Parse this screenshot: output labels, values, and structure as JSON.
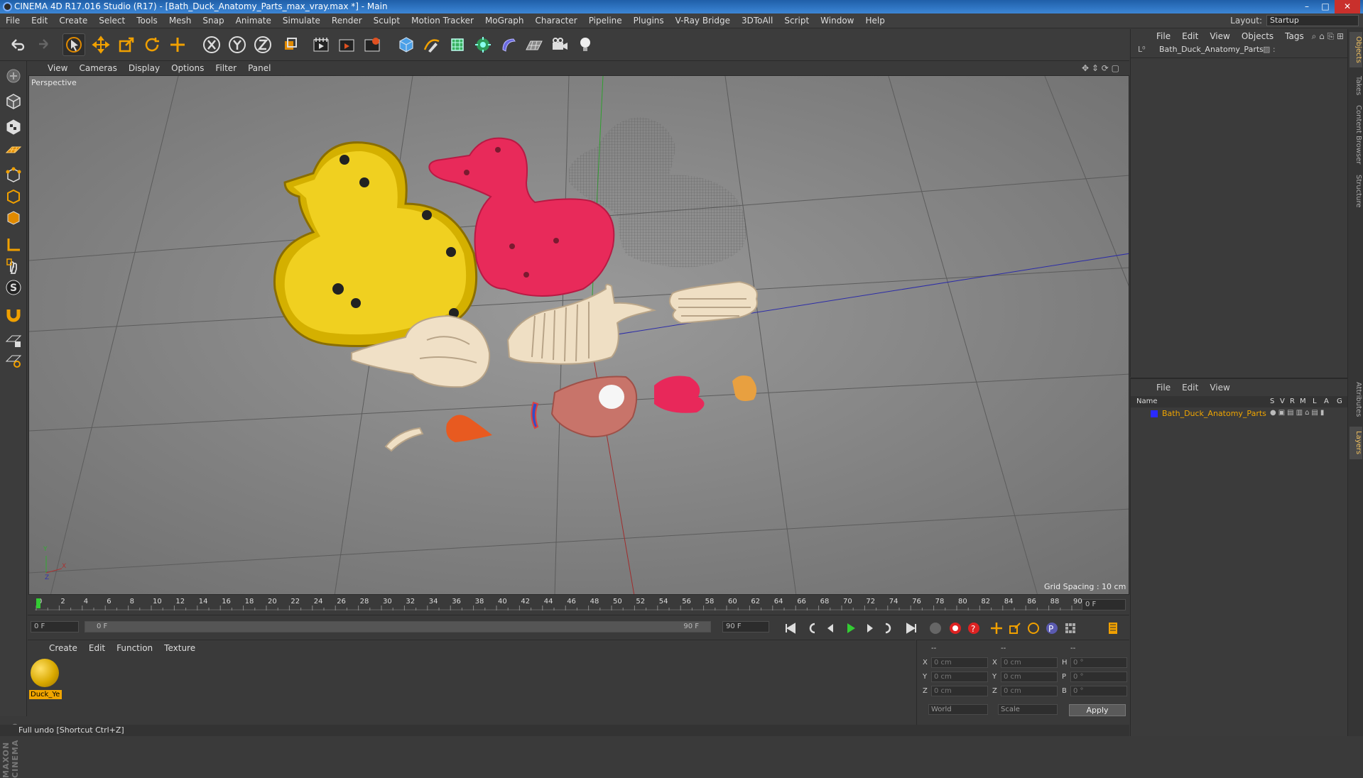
{
  "window": {
    "title": "CINEMA 4D R17.016 Studio (R17) - [Bath_Duck_Anatomy_Parts_max_vray.max *] - Main",
    "min": "–",
    "max": "□",
    "close": "✕"
  },
  "menubar": {
    "items": [
      "File",
      "Edit",
      "Create",
      "Select",
      "Tools",
      "Mesh",
      "Snap",
      "Animate",
      "Simulate",
      "Render",
      "Sculpt",
      "Motion Tracker",
      "MoGraph",
      "Character",
      "Pipeline",
      "Plugins",
      "V-Ray Bridge",
      "3DToAll",
      "Script",
      "Window",
      "Help"
    ],
    "layout_label": "Layout:",
    "layout_value": "Startup"
  },
  "viewport": {
    "menu": [
      "View",
      "Cameras",
      "Display",
      "Options",
      "Filter",
      "Panel"
    ],
    "label": "Perspective",
    "grid_spacing": "Grid Spacing : 10 cm",
    "axis_y": "Y",
    "axis_x": "X",
    "axis_z": "Z"
  },
  "timeline": {
    "ticks": [
      "0",
      "2",
      "4",
      "6",
      "8",
      "10",
      "12",
      "14",
      "16",
      "18",
      "20",
      "22",
      "24",
      "26",
      "28",
      "30",
      "32",
      "34",
      "36",
      "38",
      "40",
      "42",
      "44",
      "46",
      "48",
      "50",
      "52",
      "54",
      "56",
      "58",
      "60",
      "62",
      "64",
      "66",
      "68",
      "70",
      "72",
      "74",
      "76",
      "78",
      "80",
      "82",
      "84",
      "86",
      "88",
      "90"
    ],
    "current_frame": "0 F",
    "start_field": "0 F",
    "range_start": "0 F",
    "range_end": "90 F",
    "end_field": "90 F"
  },
  "materials": {
    "menu": [
      "Create",
      "Edit",
      "Function",
      "Texture"
    ],
    "items": [
      {
        "name": "Duck_Ye"
      }
    ]
  },
  "coordinates": {
    "headers": [
      "--",
      "--",
      "--"
    ],
    "rows": [
      {
        "l1": "X",
        "v1": "0 cm",
        "l2": "X",
        "v2": "0 cm",
        "l3": "H",
        "v3": "0 °"
      },
      {
        "l1": "Y",
        "v1": "0 cm",
        "l2": "Y",
        "v2": "0 cm",
        "l3": "P",
        "v3": "0 °"
      },
      {
        "l1": "Z",
        "v1": "0 cm",
        "l2": "Z",
        "v2": "0 cm",
        "l3": "B",
        "v3": "0 °"
      }
    ],
    "mode1": "World",
    "mode2": "Scale",
    "apply": "Apply"
  },
  "status": "Full undo [Shortcut Ctrl+Z]",
  "objects": {
    "menu": [
      "File",
      "Edit",
      "View",
      "Objects",
      "Tags"
    ],
    "tree": [
      {
        "name": "Bath_Duck_Anatomy_Parts"
      }
    ]
  },
  "layers": {
    "menu": [
      "File",
      "Edit",
      "View"
    ],
    "columns": [
      "Name",
      "S",
      "V",
      "R",
      "M",
      "L",
      "A",
      "G"
    ],
    "items": [
      {
        "name": "Bath_Duck_Anatomy_Parts",
        "color": "#2a2aff"
      }
    ]
  },
  "side_tabs": [
    "Objects",
    "Takes",
    "Content Browser",
    "Structure",
    "Attributes",
    "Layers"
  ],
  "colors": {
    "accent": "#f0a500",
    "layer_highlight": "#f0a500"
  }
}
